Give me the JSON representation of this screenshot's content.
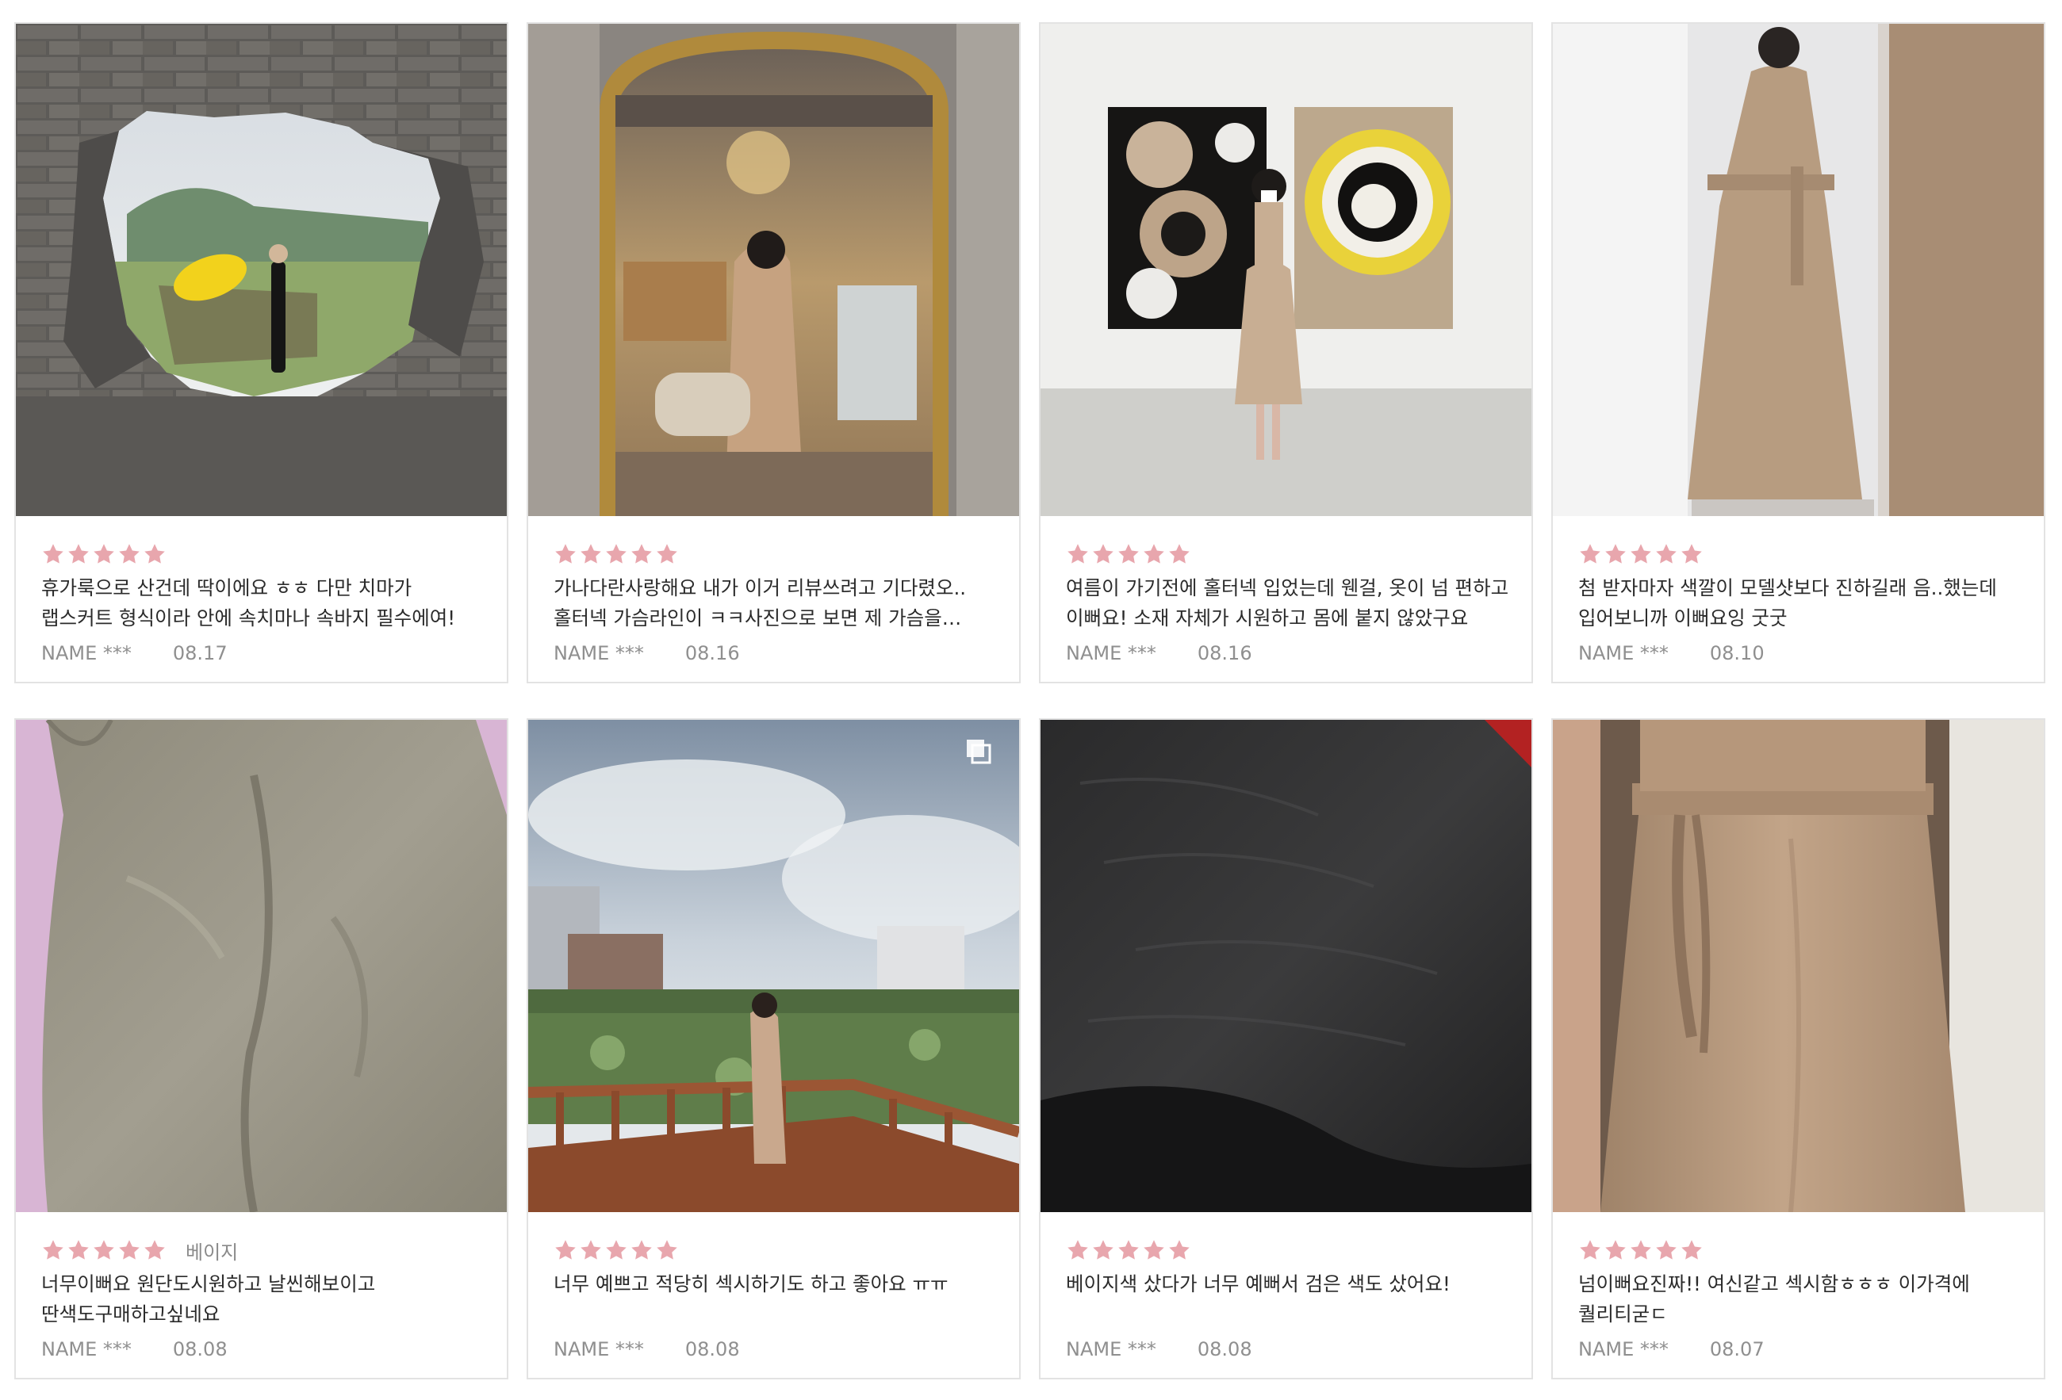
{
  "colors": {
    "star": "#e8a6ad",
    "card_border": "#e3e3e3",
    "text": "#2b2b2b",
    "muted": "#8f8f8f"
  },
  "reviews": [
    {
      "rating": 5,
      "option": "",
      "text": "휴가룩으로 산건데 딱이에요 ㅎㅎ 다만 치마가 랩스커트 형식이라 안에 속치마나 속바지 필수에여!",
      "name": "NAME ***",
      "date": "08.17",
      "photo": "woman-yellow-umbrella-through-stone-wall",
      "multi_image": false
    },
    {
      "rating": 5,
      "option": "",
      "text": "가나다란사랑해요 내가 이거 리뷰쓰려고 기다렸오.. 홀터넥 가슴라인이 ㅋㅋ사진으로 보면 제 가슴을 드러내는 것 같아요",
      "name": "NAME ***",
      "date": "08.16",
      "photo": "mirror-selfie-cafe",
      "multi_image": false
    },
    {
      "rating": 5,
      "option": "",
      "text": "여름이 가기전에 홀터넥 입었는데 웬걸, 옷이 넘 편하고 이뻐요! 소재 자체가 시원하고 몸에 붙지 않았구요",
      "name": "NAME ***",
      "date": "08.16",
      "photo": "woman-gallery-paintings",
      "multi_image": false
    },
    {
      "rating": 5,
      "option": "",
      "text": "첨 받자마자 색깔이 모델샷보다 진하길래 음..했는데 입어보니까 이뻐요잉 굿굿",
      "name": "NAME ***",
      "date": "08.10",
      "photo": "mirror-selfie-beige-dress",
      "multi_image": false
    },
    {
      "rating": 5,
      "option": "베이지",
      "text": "너무이뻐요 원단도시원하고 날씬해보이고 딴색도구매하고싶네요",
      "name": "NAME ***",
      "date": "08.08",
      "photo": "fabric-closeup-beige",
      "multi_image": false
    },
    {
      "rating": 5,
      "option": "",
      "text": "너무 예쁘고 적당히 섹시하기도 하고 좋아요 ㅠㅠ",
      "name": "NAME ***",
      "date": "08.08",
      "photo": "woman-lotus-pond-railing",
      "multi_image": true
    },
    {
      "rating": 5,
      "option": "",
      "text": "베이지색 샀다가 너무 예뻐서 검은 색도 샀어요!",
      "name": "NAME ***",
      "date": "08.08",
      "photo": "fabric-closeup-black",
      "multi_image": false
    },
    {
      "rating": 5,
      "option": "",
      "text": "넘이뻐요진짜!! 여신같고 섹시함ㅎㅎㅎ 이가격에 퀄리티굳ㄷ",
      "name": "NAME ***",
      "date": "08.07",
      "photo": "beige-wrap-skirt-closeup",
      "multi_image": false
    }
  ]
}
